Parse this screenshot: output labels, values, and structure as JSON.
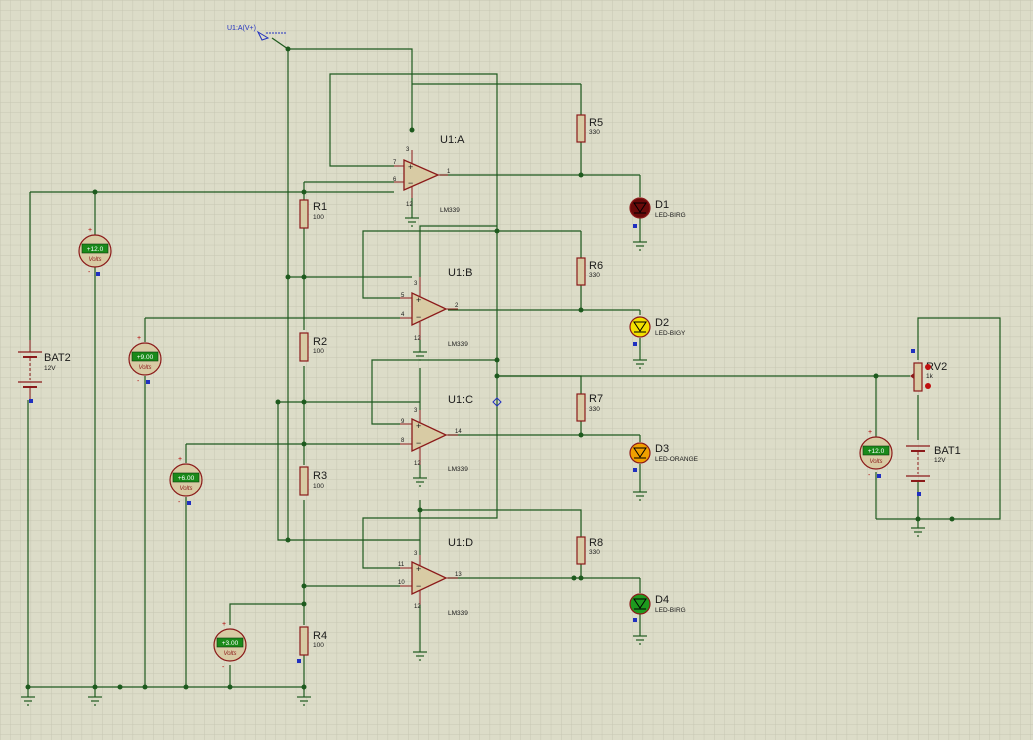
{
  "probe": {
    "label": "U1:A(V+)"
  },
  "opamps": [
    {
      "name": "U1:A",
      "model": "LM339",
      "pin_plus": "7",
      "pin_minus": "6",
      "pin_out": "1",
      "pin_vcc": "3",
      "pin_gnd": "12"
    },
    {
      "name": "U1:B",
      "model": "LM339",
      "pin_plus": "5",
      "pin_minus": "4",
      "pin_out": "2",
      "pin_vcc": "3",
      "pin_gnd": "12"
    },
    {
      "name": "U1:C",
      "model": "LM339",
      "pin_plus": "9",
      "pin_minus": "8",
      "pin_out": "14",
      "pin_vcc": "3",
      "pin_gnd": "12"
    },
    {
      "name": "U1:D",
      "model": "LM339",
      "pin_plus": "11",
      "pin_minus": "10",
      "pin_out": "13",
      "pin_vcc": "3",
      "pin_gnd": "12"
    }
  ],
  "divider_resistors": [
    {
      "name": "R1",
      "value": "100"
    },
    {
      "name": "R2",
      "value": "100"
    },
    {
      "name": "R3",
      "value": "100"
    },
    {
      "name": "R4",
      "value": "100"
    }
  ],
  "pullup_resistors": [
    {
      "name": "R5",
      "value": "330"
    },
    {
      "name": "R6",
      "value": "330"
    },
    {
      "name": "R7",
      "value": "330"
    },
    {
      "name": "R8",
      "value": "330"
    }
  ],
  "leds": [
    {
      "name": "D1",
      "model": "LED-BIRG",
      "color": "#6a0a0a"
    },
    {
      "name": "D2",
      "model": "LED-BIGY",
      "color": "#f2e000"
    },
    {
      "name": "D3",
      "model": "LED-ORANGE",
      "color": "#f0a000"
    },
    {
      "name": "D4",
      "model": "LED-BIRG",
      "color": "#1e9a1e"
    }
  ],
  "voltmeters": [
    {
      "reading": "+12.0",
      "unit": "Volts",
      "plus": "+",
      "minus": "-"
    },
    {
      "reading": "+9.00",
      "unit": "Volts",
      "plus": "+",
      "minus": "-"
    },
    {
      "reading": "+6.00",
      "unit": "Volts",
      "plus": "+",
      "minus": "-"
    },
    {
      "reading": "+3.00",
      "unit": "Volts",
      "plus": "+",
      "minus": "-"
    },
    {
      "reading": "+12.0",
      "unit": "Volts",
      "plus": "+",
      "minus": "-"
    }
  ],
  "batteries": [
    {
      "name": "BAT2",
      "value": "12V"
    },
    {
      "name": "BAT1",
      "value": "12V"
    }
  ],
  "potentiometer": {
    "name": "RV2",
    "value": "1k"
  },
  "colors": {
    "wire": "#1e5a1e",
    "component": "#8b1a1a",
    "grid": "#c8c8b4",
    "background": "#dcdcc8",
    "probe": "#2030c0",
    "meter_display": "#1a8a1a"
  }
}
